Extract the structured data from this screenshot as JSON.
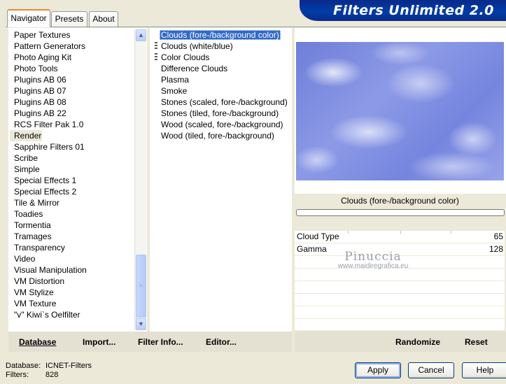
{
  "tabs": [
    {
      "label": "Navigator",
      "active": true
    },
    {
      "label": "Presets",
      "active": false
    },
    {
      "label": "About",
      "active": false
    }
  ],
  "banner": {
    "title": "Filters Unlimited 2.0"
  },
  "categories": {
    "items": [
      "Paper Textures",
      "Pattern Generators",
      "Photo Aging Kit",
      "Photo Tools",
      "Plugins AB 06",
      "Plugins AB 07",
      "Plugins AB 08",
      "Plugins AB 22",
      "RCS Filter Pak 1.0",
      "Render",
      "Sapphire Filters 01",
      "Scribe",
      "Simple",
      "Special Effects 1",
      "Special Effects 2",
      "Tile & Mirror",
      "Toadies",
      "Tormentia",
      "Tramages",
      "Transparency",
      "Video",
      "Visual Manipulation",
      "VM Distortion",
      "VM Stylize",
      "VM Texture",
      "\"v\" Kiwi`s Oelfilter"
    ],
    "selected": "Render"
  },
  "filters": {
    "items": [
      "Clouds (fore-/background color)",
      "Clouds (white/blue)",
      "Color Clouds",
      "Difference Clouds",
      "Plasma",
      "Smoke",
      "Stones (scaled, fore-/background)",
      "Stones (tiled, fore-/background)",
      "Wood (scaled, fore-/background)",
      "Wood (tiled, fore-/background)"
    ],
    "selected": "Clouds (fore-/background color)"
  },
  "preview": {
    "filter_name": "Clouds (fore-/background color)"
  },
  "params": [
    {
      "name": "Cloud Type",
      "value": "65"
    },
    {
      "name": "Gamma",
      "value": "128"
    }
  ],
  "watermark": {
    "line1": "Pinuccia",
    "line2": "www.maidiregrafica.eu"
  },
  "left_bar": {
    "database": "Database",
    "import": "Import...",
    "filter_info": "Filter Info...",
    "editor": "Editor..."
  },
  "right_bar": {
    "randomize": "Randomize",
    "reset": "Reset"
  },
  "status": {
    "database_label": "Database:",
    "database_value": "ICNET-Filters",
    "filters_label": "Filters:",
    "filters_value": "828"
  },
  "dialog_buttons": {
    "apply": "Apply",
    "cancel": "Cancel",
    "help": "Help"
  }
}
